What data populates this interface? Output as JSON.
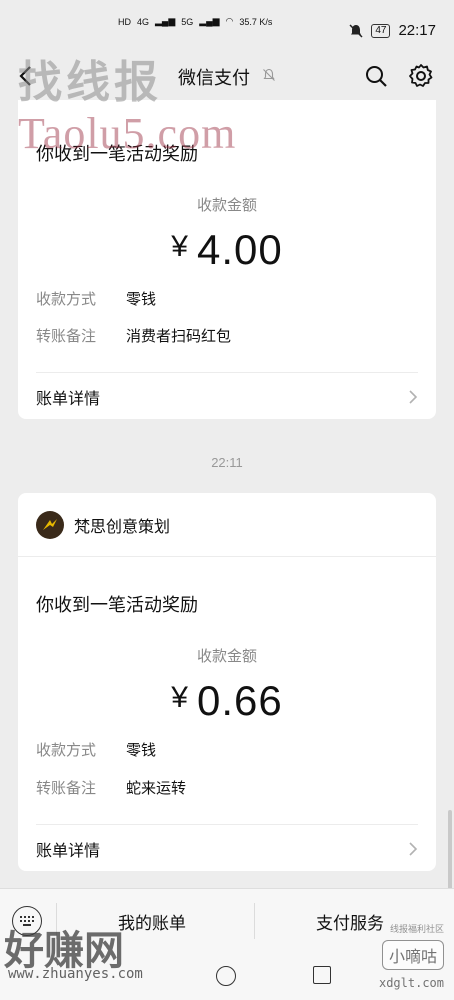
{
  "status_bar": {
    "network_1": "HD",
    "network_2": "HD",
    "signal_1": "4G",
    "signal_2": "5G",
    "speed": "35.7",
    "speed_unit": "K/s",
    "battery": "47",
    "time": "22:17"
  },
  "nav": {
    "title": "微信支付"
  },
  "watermarks": {
    "top_cn": "找线报",
    "top_en": "Taolu5.com",
    "bottom_cn": "好赚网",
    "bottom_url": "www.zhuanyes.com",
    "right_small": "线报福利社区",
    "right_box": "小嘀咕",
    "right_url": "xdglt.com"
  },
  "card1": {
    "headline": "你收到一笔活动奖励",
    "amount_label": "收款金额",
    "currency": "¥",
    "amount": "4.00",
    "method_key": "收款方式",
    "method_value": "零钱",
    "note_key": "转账备注",
    "note_value": "消费者扫码红包",
    "detail_label": "账单详情"
  },
  "timestamp": "22:11",
  "card2": {
    "merchant": "梵思创意策划",
    "headline": "你收到一笔活动奖励",
    "amount_label": "收款金额",
    "currency": "¥",
    "amount": "0.66",
    "method_key": "收款方式",
    "method_value": "零钱",
    "note_key": "转账备注",
    "note_value": "蛇来运转",
    "detail_label": "账单详情"
  },
  "bottom_menu": {
    "item1": "我的账单",
    "item2": "支付服务"
  },
  "colors": {
    "background": "#ededed",
    "card": "#ffffff",
    "muted_text": "#888888"
  }
}
